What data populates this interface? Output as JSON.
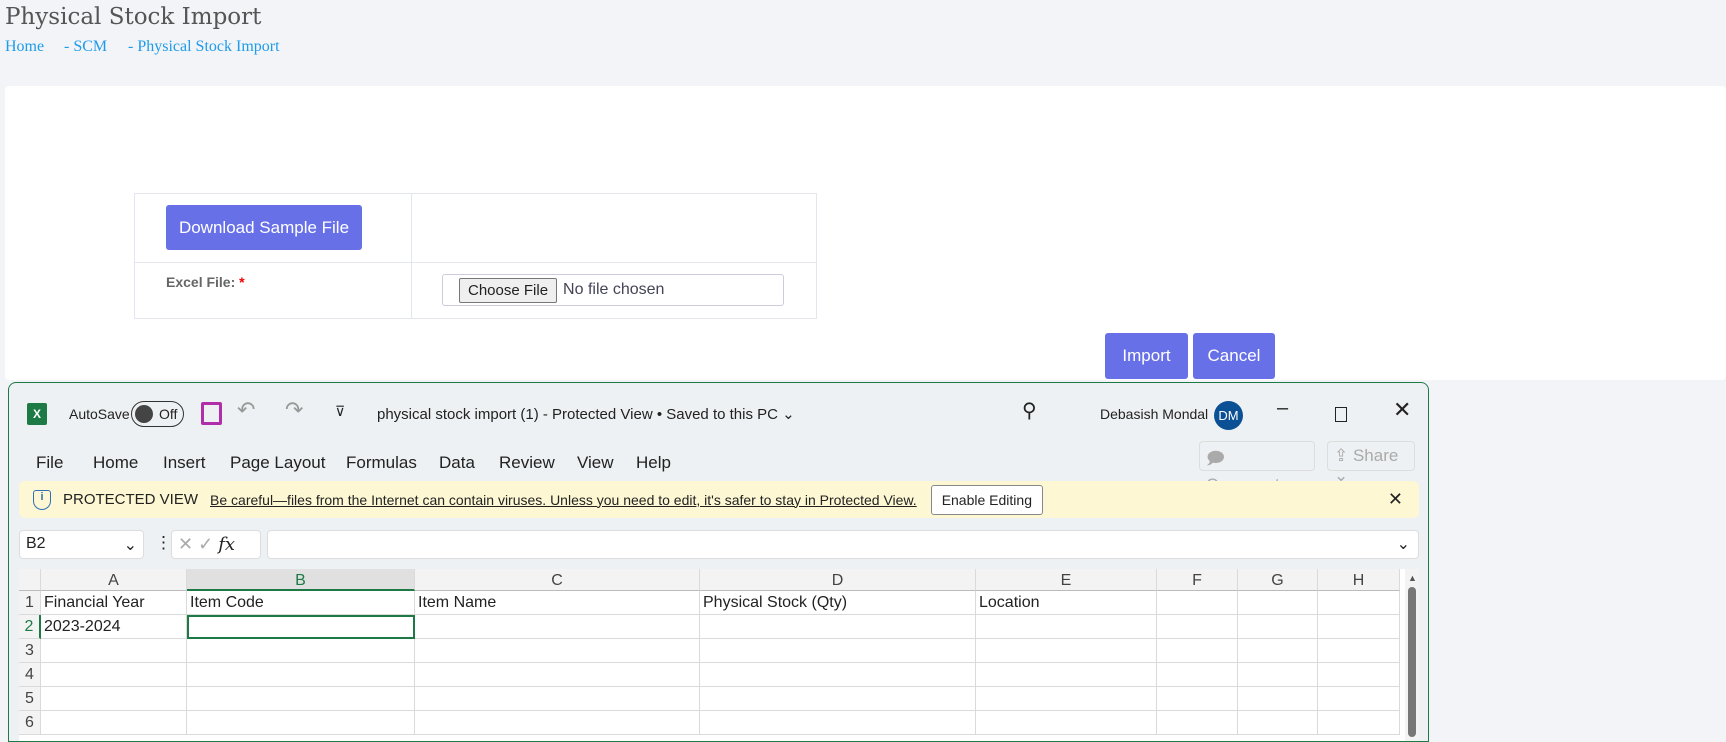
{
  "page": {
    "title": "Physical Stock Import",
    "breadcrumb": [
      "Home",
      "- SCM",
      "- Physical Stock Import"
    ]
  },
  "form": {
    "download_label": "Download Sample File",
    "excel_label": "Excel File:",
    "required_mark": "*",
    "choose_file": "Choose File",
    "no_file": "No file chosen",
    "import_label": "Import",
    "cancel_label": "Cancel"
  },
  "excel": {
    "autosave": "AutoSave",
    "toggle": "Off",
    "doc_title": "physical stock import (1)  -  Protected View  •  Saved to this PC",
    "user": "Debasish Mondal",
    "initials": "DM",
    "menu": [
      "File",
      "Home",
      "Insert",
      "Page Layout",
      "Formulas",
      "Data",
      "Review",
      "View",
      "Help"
    ],
    "comments": "Comments",
    "share": "Share",
    "protected": {
      "title": "PROTECTED VIEW",
      "message": "Be careful—files from the Internet can contain viruses. Unless you need to edit, it's safer to stay in Protected View.",
      "button": "Enable Editing"
    },
    "name_box": "B2",
    "fx": "fx",
    "columns": [
      "A",
      "B",
      "C",
      "D",
      "E",
      "F",
      "G",
      "H"
    ],
    "rows": [
      [
        "Financial Year",
        "Item Code",
        "Item Name",
        "Physical Stock (Qty)",
        "Location",
        "",
        "",
        ""
      ],
      [
        "2023-2024",
        "",
        "",
        "",
        "",
        "",
        "",
        ""
      ],
      [
        "",
        "",
        "",
        "",
        "",
        "",
        "",
        ""
      ],
      [
        "",
        "",
        "",
        "",
        "",
        "",
        "",
        ""
      ],
      [
        "",
        "",
        "",
        "",
        "",
        "",
        "",
        ""
      ],
      [
        "",
        "",
        "",
        "",
        "",
        "",
        "",
        ""
      ]
    ],
    "row_numbers": [
      "1",
      "2",
      "3",
      "4",
      "5",
      "6"
    ],
    "selected_cell": "B2",
    "accent": "#1d7a45"
  }
}
